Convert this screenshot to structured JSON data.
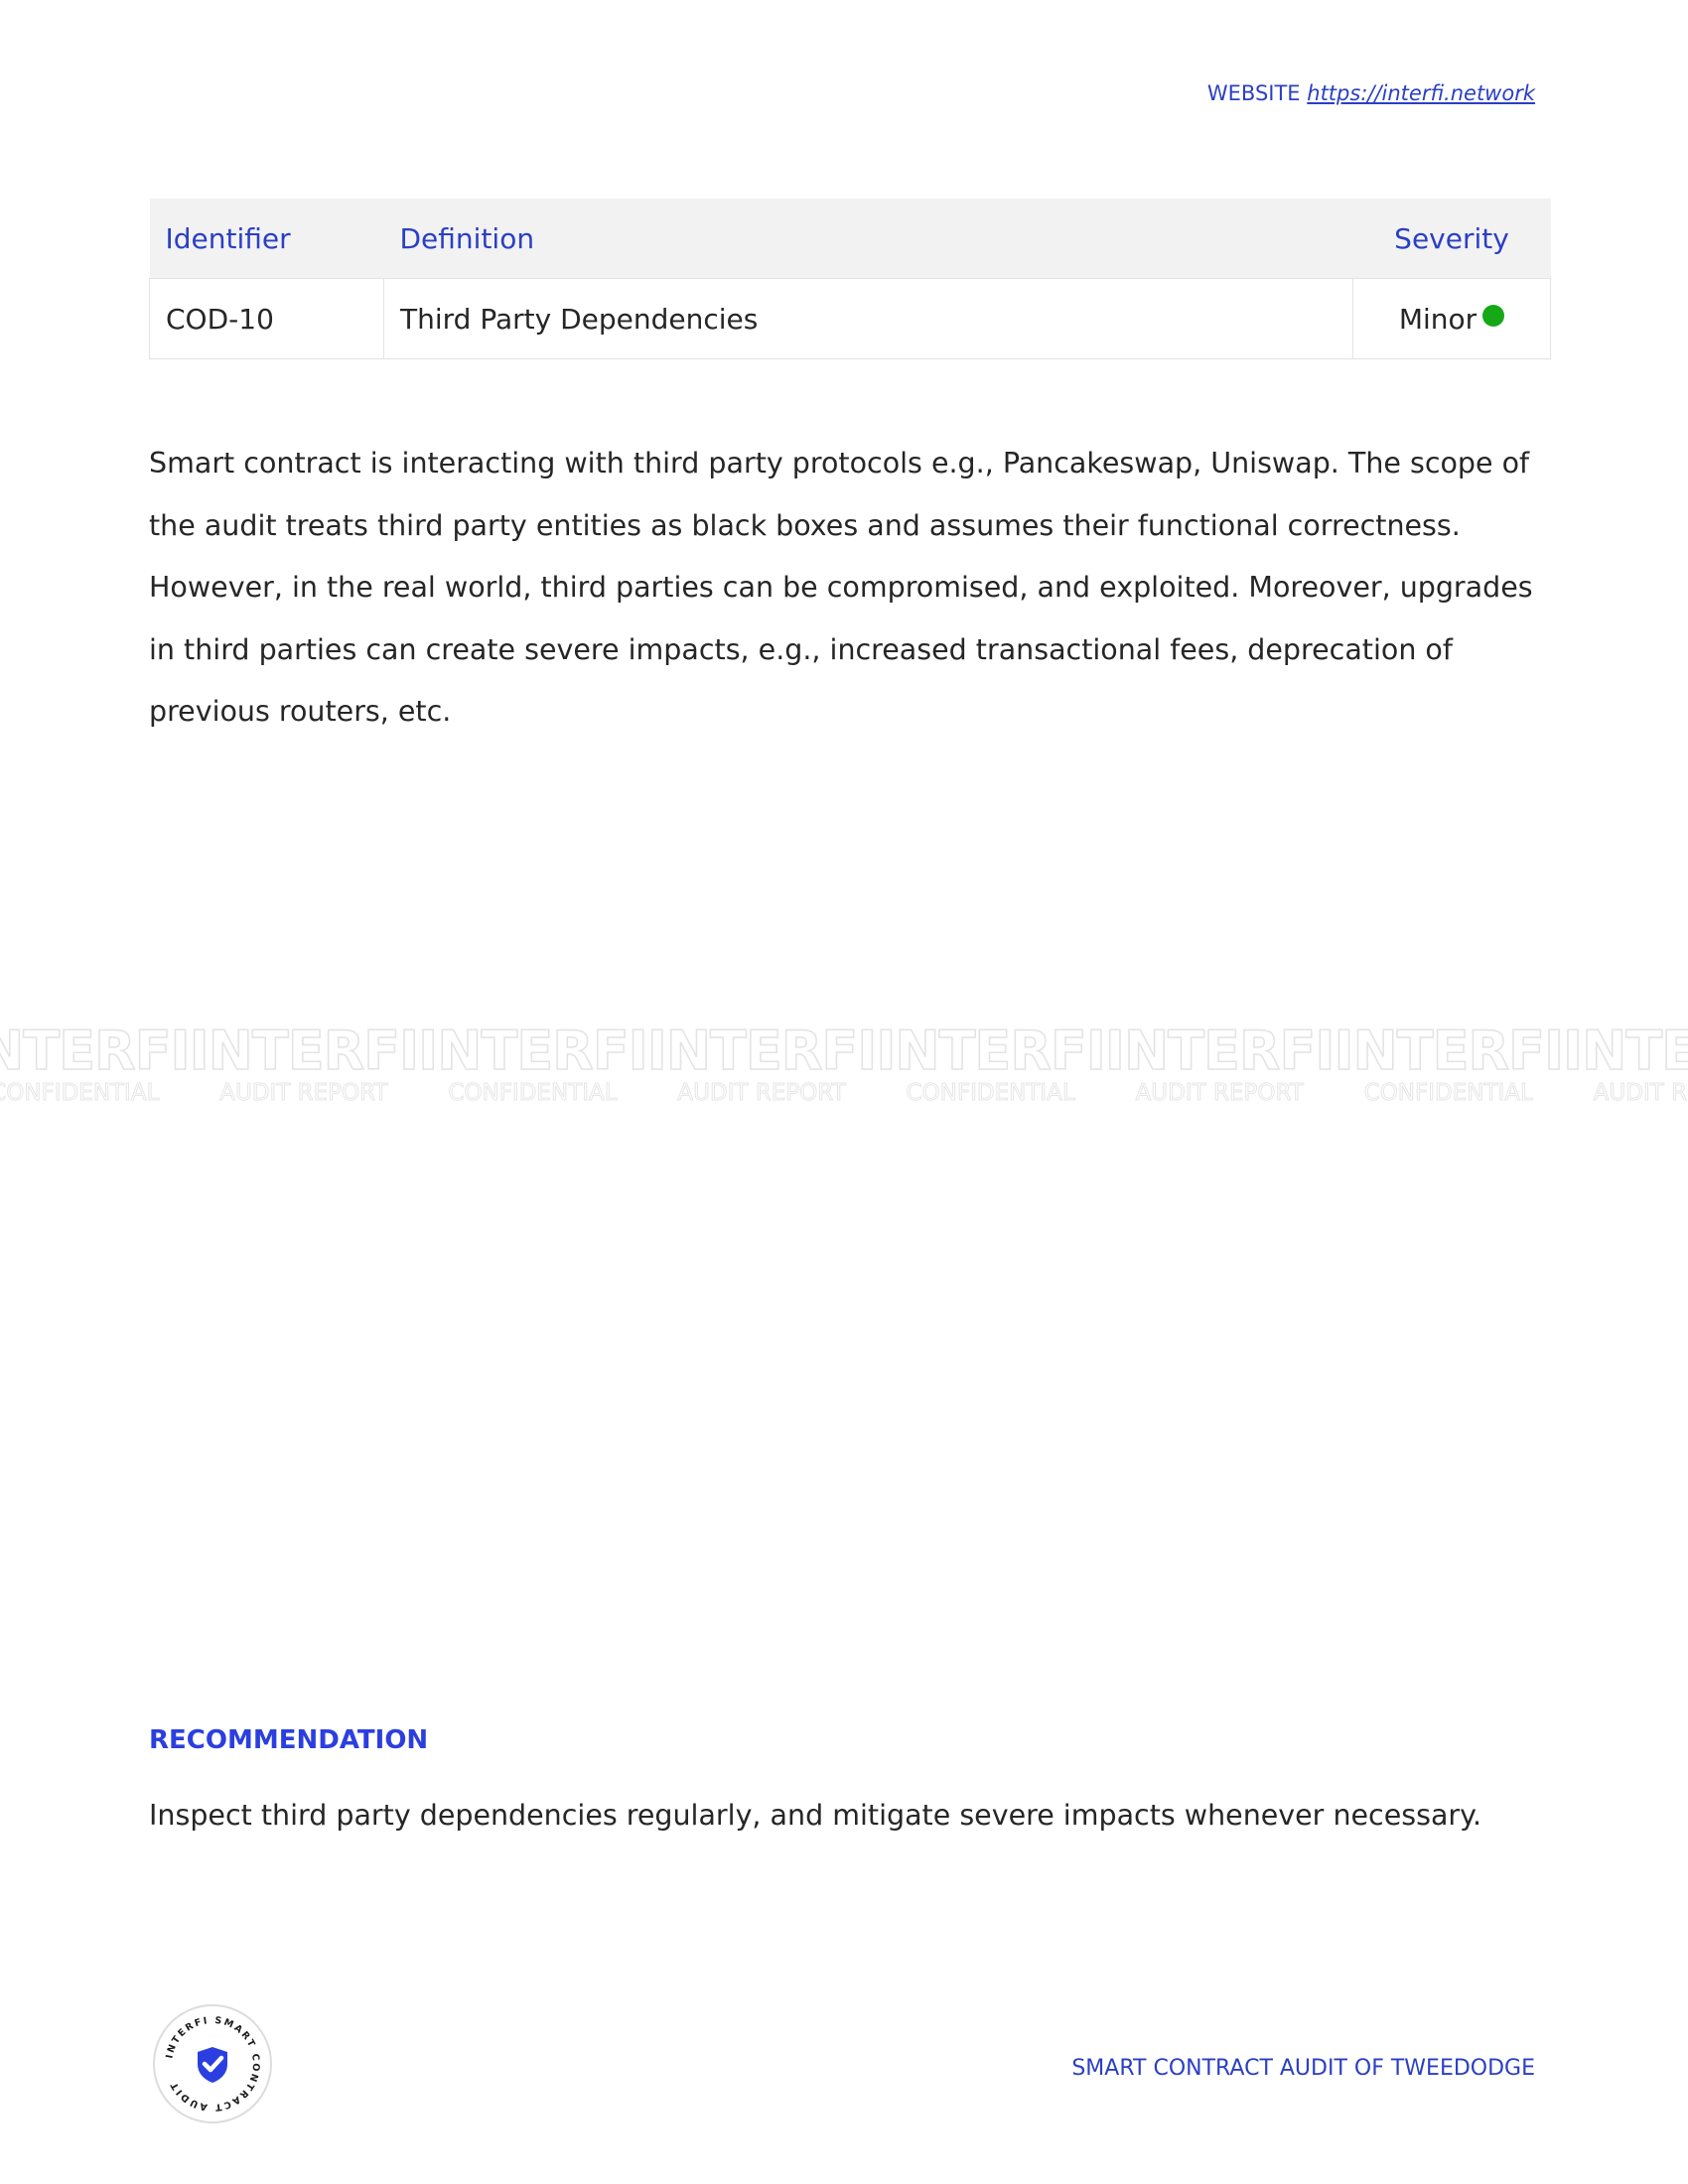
{
  "header": {
    "website_label": "WEBSITE",
    "website_url": "https://interfi.network"
  },
  "table": {
    "headers": [
      "Identifier",
      "Definition",
      "Severity"
    ],
    "rows": [
      {
        "identifier": "COD-10",
        "definition": "Third Party Dependencies",
        "severity": "Minor",
        "severity_color": "#16a816"
      }
    ]
  },
  "description": "Smart contract is interacting with third party protocols e.g., Pancakeswap, Uniswap. The scope of the audit treats third party entities as black boxes and assumes their functional correctness. However, in the real world, third parties can be compromised, and exploited. Moreover, upgrades in third parties can create severe impacts, e.g., increased transactional fees, deprecation of previous routers, etc.",
  "watermark": {
    "brand": "INTERFI",
    "captions": [
      "CONFIDENTIAL",
      "AUDIT REPORT"
    ]
  },
  "recommendation": {
    "heading": "RECOMMENDATION",
    "text": "Inspect third party dependencies regularly, and mitigate severe impacts whenever necessary."
  },
  "seal": {
    "text": "INTERFI SMART CONTRACT AUDIT",
    "icon": "shield-check-icon"
  },
  "footer": {
    "text": "SMART CONTRACT AUDIT OF TWEEDODGE"
  },
  "colors": {
    "accent": "#2b3fc4",
    "heading_accent": "#2b3fe0",
    "table_header_bg": "#f2f2f2"
  }
}
